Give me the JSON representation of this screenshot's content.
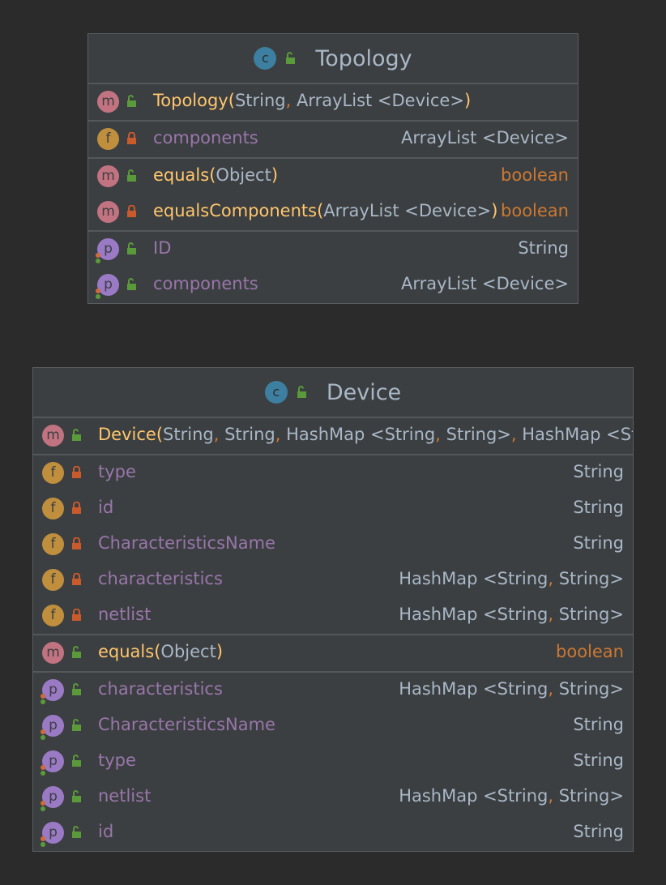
{
  "topology": {
    "kind_badge": "c",
    "name": "Topology",
    "constructors": [
      {
        "badge": "m",
        "visibility": "public",
        "name": "Topology",
        "params": [
          "String",
          "ArrayList <Device>"
        ]
      }
    ],
    "fields": [
      {
        "badge": "f",
        "visibility": "private",
        "name": "components",
        "type": "ArrayList <Device>"
      }
    ],
    "methods": [
      {
        "badge": "m",
        "visibility": "public",
        "name": "equals",
        "params": [
          "Object"
        ],
        "type": "boolean"
      },
      {
        "badge": "m",
        "visibility": "private",
        "name": "equalsComponents",
        "params": [
          "ArrayList <Device>"
        ],
        "type": "boolean"
      }
    ],
    "properties": [
      {
        "badge": "p",
        "visibility": "public",
        "name": "ID",
        "type": "String"
      },
      {
        "badge": "p",
        "visibility": "public",
        "name": "components",
        "type": "ArrayList <Device>"
      }
    ]
  },
  "device": {
    "kind_badge": "c",
    "name": "Device",
    "constructors": [
      {
        "badge": "m",
        "visibility": "public",
        "name": "Device",
        "params": [
          "String",
          "String",
          "HashMap <String",
          "String>",
          "HashMap <Stri"
        ]
      }
    ],
    "fields": [
      {
        "badge": "f",
        "visibility": "private",
        "name": "type",
        "type": "String"
      },
      {
        "badge": "f",
        "visibility": "private",
        "name": "id",
        "type": "String"
      },
      {
        "badge": "f",
        "visibility": "private",
        "name": "CharacteristicsName",
        "type": "String"
      },
      {
        "badge": "f",
        "visibility": "private",
        "name": "characteristics",
        "type_parts": [
          "HashMap <String",
          "String>"
        ]
      },
      {
        "badge": "f",
        "visibility": "private",
        "name": "netlist",
        "type_parts": [
          "HashMap <String",
          "String>"
        ]
      }
    ],
    "methods": [
      {
        "badge": "m",
        "visibility": "public",
        "name": "equals",
        "params": [
          "Object"
        ],
        "type": "boolean"
      }
    ],
    "properties": [
      {
        "badge": "p",
        "visibility": "public",
        "name": "characteristics",
        "type_parts": [
          "HashMap <String",
          "String>"
        ]
      },
      {
        "badge": "p",
        "visibility": "public",
        "name": "CharacteristicsName",
        "type": "String"
      },
      {
        "badge": "p",
        "visibility": "public",
        "name": "type",
        "type": "String"
      },
      {
        "badge": "p",
        "visibility": "public",
        "name": "netlist",
        "type_parts": [
          "HashMap <String",
          "String>"
        ]
      },
      {
        "badge": "p",
        "visibility": "public",
        "name": "id",
        "type": "String"
      }
    ]
  },
  "colors": {
    "background": "#2b2b2b",
    "box": "#3c3f41",
    "method_name": "#ffc66d",
    "member_name": "#9876aa",
    "keyword": "#cc7832",
    "text": "#a9b7c6",
    "public_lock": "#5a9a3a",
    "private_lock": "#c95a2c"
  }
}
